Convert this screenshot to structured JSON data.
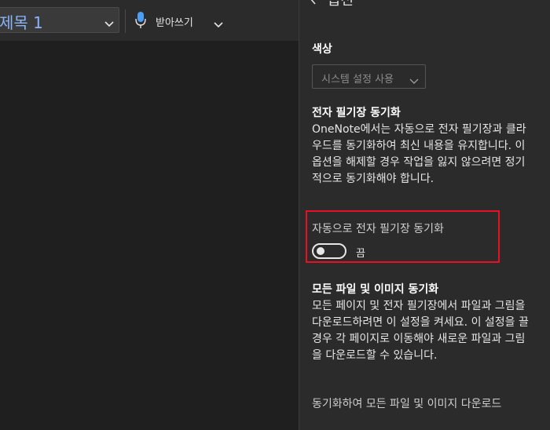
{
  "toolbar": {
    "style_value": "제목 1",
    "dictate_label": "받아쓰기"
  },
  "panel": {
    "title": "옵션",
    "color": {
      "label": "색상",
      "select_value": "시스템 설정 사용"
    },
    "notebook_sync": {
      "heading": "전자 필기장 동기화",
      "body": "OneNote에서는 자동으로 전자 필기장과 클라우드를 동기화하여 최신 내용을 유지합니다. 이 옵션을 해제할 경우 작업을 잃지 않으려면 정기적으로 동기화해야 합니다.",
      "toggle_label": "자동으로 전자 필기장 동기화",
      "toggle_state": "끔",
      "toggle_on": false
    },
    "file_sync": {
      "heading": "모든 파일 및 이미지 동기화",
      "body": "모든 페이지 및 전자 필기장에서 파일과 그림을 다운로드하려면 이 설정을 켜세요. 이 설정을 끌 경우 각 페이지로 이동해야 새로운 파일과 그림을 다운로드할 수 있습니다.",
      "action": "동기화하여 모든 파일 및 이미지 다운로드"
    }
  },
  "colors": {
    "accent_highlight": "#e81123",
    "heading_blue": "#8ab4f8"
  }
}
